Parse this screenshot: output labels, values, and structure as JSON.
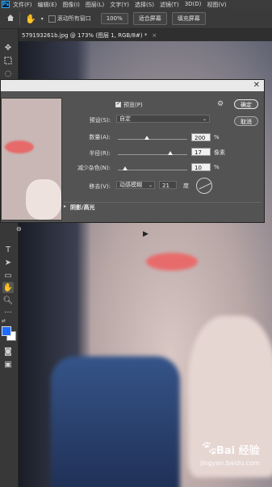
{
  "menubar": {
    "logo": "Ps",
    "items": [
      "文件(F)",
      "编辑(E)",
      "图像(I)",
      "图层(L)",
      "文字(Y)",
      "选择(S)",
      "滤镜(T)",
      "3D(D)",
      "视图(V)"
    ]
  },
  "options": {
    "scroll_all": "滚动所有窗口",
    "zoom": "100%",
    "fit_screen": "适合屏幕",
    "fill_screen": "填充屏幕"
  },
  "document": {
    "tab_title": "579193261b.jpg @ 173% (图层 1, RGB/8#) *",
    "close": "×"
  },
  "dialog": {
    "preview_label": "预览(P)",
    "ok_label": "确定",
    "cancel_label": "取消",
    "preset_label": "预设(S):",
    "preset_value": "自定",
    "amount_label": "数量(A):",
    "amount_value": "200",
    "amount_unit": "%",
    "radius_label": "半径(R):",
    "radius_value": "17",
    "radius_unit": "像素",
    "noise_label": "减少杂色(N):",
    "noise_value": "10",
    "noise_unit": "%",
    "remove_label": "移去(V):",
    "remove_value": "动感模糊",
    "angle_value": "21",
    "angle_unit": "度",
    "section_label": "阴影/高光",
    "sliders": {
      "amount": 0.42,
      "radius": 0.75,
      "noise": 0.1
    }
  },
  "watermark": {
    "brand": "Bai",
    "site_cn": "经验",
    "url": "jingyan.baidu.com"
  }
}
